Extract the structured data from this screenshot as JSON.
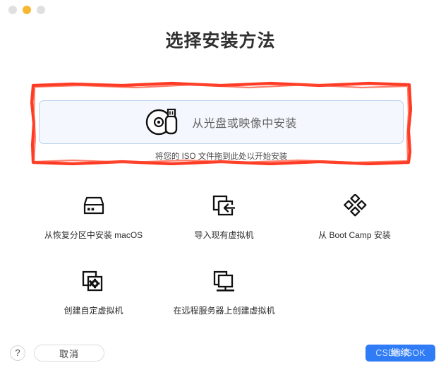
{
  "window": {
    "traffic_lights": [
      {
        "name": "close",
        "color": "#e0e0e0"
      },
      {
        "name": "minimize",
        "color": "#f7b733"
      },
      {
        "name": "zoom",
        "color": "#e0e0e0"
      }
    ]
  },
  "header": {
    "title": "选择安装方法"
  },
  "dropzone": {
    "icon": "disc-and-usb-icon",
    "label": "从光盘或映像中安装",
    "hint": "将您的 ISO 文件拖到此处以开始安装",
    "highlight_color": "#ff2b14",
    "box_border_color": "#b9d0ec",
    "box_background_color": "#f4f8fe"
  },
  "options": {
    "row_a": [
      {
        "icon": "hard-drive-icon",
        "label": "从恢复分区中安装 macOS"
      },
      {
        "icon": "import-vm-icon",
        "label": "导入现有虚拟机"
      },
      {
        "icon": "boot-camp-diamond-icon",
        "label": "从 Boot Camp 安装"
      }
    ],
    "row_b": [
      {
        "icon": "custom-vm-gear-icon",
        "label": "创建自定虚拟机"
      },
      {
        "icon": "remote-server-monitor-icon",
        "label": "在远程服务器上创建虚拟机"
      }
    ]
  },
  "footer": {
    "help_label": "?",
    "cancel_label": "取消",
    "continue_label": "继续",
    "watermark_text": "CSDN       ISOK",
    "continue_color": "#2f7cf6"
  }
}
